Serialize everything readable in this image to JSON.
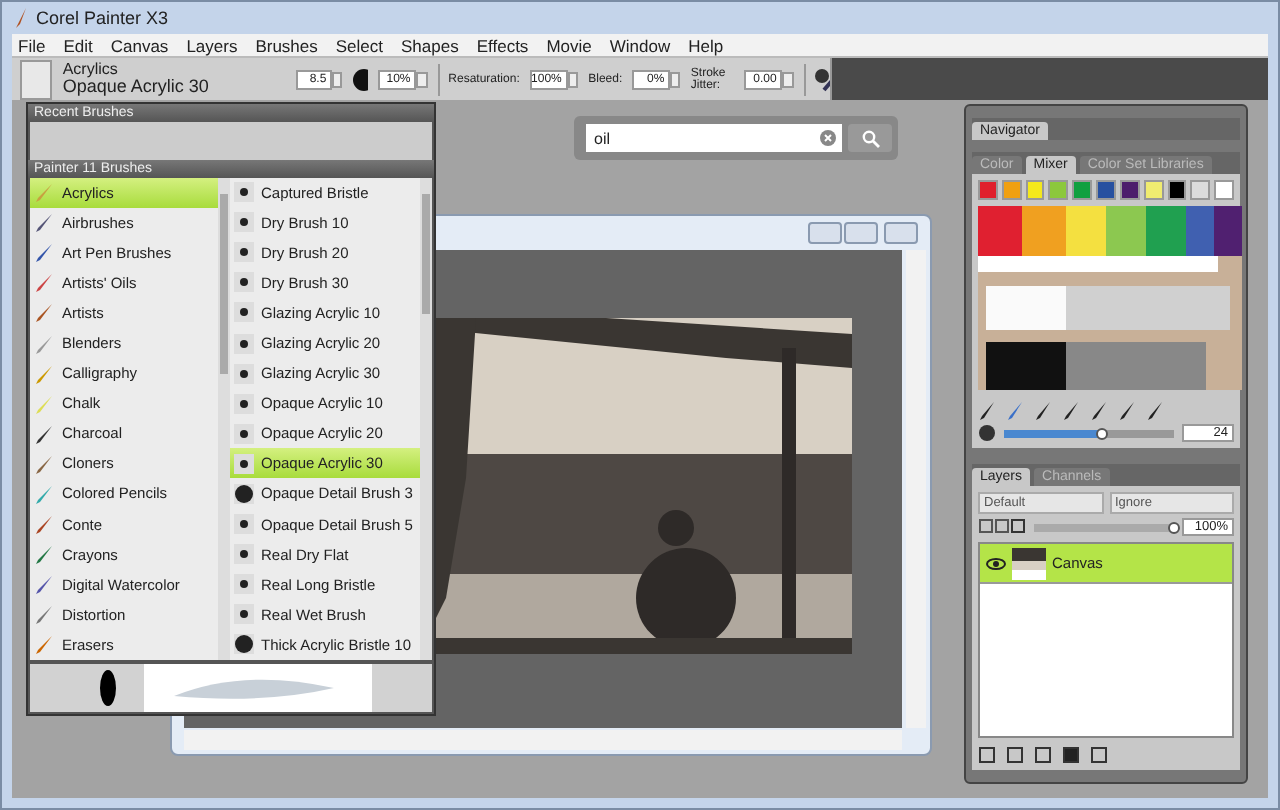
{
  "window": {
    "title": "Corel Painter X3"
  },
  "menu": [
    "File",
    "Edit",
    "Canvas",
    "Layers",
    "Brushes",
    "Select",
    "Shapes",
    "Effects",
    "Movie",
    "Window",
    "Help"
  ],
  "property_bar": {
    "category": "Acrylics",
    "variant": "Opaque Acrylic 30",
    "size": "8.5",
    "opacity": "10%",
    "resaturation_label": "Resaturation:",
    "resaturation": "100%",
    "bleed_label": "Bleed:",
    "bleed": "0%",
    "jitter_label": "Stroke Jitter:",
    "jitter": "0.00"
  },
  "brush_library": {
    "recent_title": "Recent Brushes",
    "library_title": "Painter 11 Brushes",
    "categories": [
      {
        "label": "Acrylics",
        "selected": true
      },
      {
        "label": "Airbrushes",
        "selected": false
      },
      {
        "label": "Art Pen Brushes",
        "selected": false
      },
      {
        "label": "Artists' Oils",
        "selected": false
      },
      {
        "label": "Artists",
        "selected": false
      },
      {
        "label": "Blenders",
        "selected": false
      },
      {
        "label": "Calligraphy",
        "selected": false
      },
      {
        "label": "Chalk",
        "selected": false
      },
      {
        "label": "Charcoal",
        "selected": false
      },
      {
        "label": "Cloners",
        "selected": false
      },
      {
        "label": "Colored Pencils",
        "selected": false
      },
      {
        "label": "Conte",
        "selected": false
      },
      {
        "label": "Crayons",
        "selected": false
      },
      {
        "label": "Digital Watercolor",
        "selected": false
      },
      {
        "label": "Distortion",
        "selected": false
      },
      {
        "label": "Erasers",
        "selected": false
      }
    ],
    "variants": [
      {
        "label": "Captured Bristle",
        "selected": false
      },
      {
        "label": "Dry Brush 10",
        "selected": false
      },
      {
        "label": "Dry Brush 20",
        "selected": false
      },
      {
        "label": "Dry Brush 30",
        "selected": false
      },
      {
        "label": "Glazing Acrylic 10",
        "selected": false
      },
      {
        "label": "Glazing Acrylic 20",
        "selected": false
      },
      {
        "label": "Glazing Acrylic 30",
        "selected": false
      },
      {
        "label": "Opaque Acrylic 10",
        "selected": false
      },
      {
        "label": "Opaque Acrylic 20",
        "selected": false
      },
      {
        "label": "Opaque Acrylic 30",
        "selected": true
      },
      {
        "label": "Opaque Detail Brush 3",
        "selected": false
      },
      {
        "label": "Opaque Detail Brush 5",
        "selected": false
      },
      {
        "label": "Real Dry Flat",
        "selected": false
      },
      {
        "label": "Real Long Bristle",
        "selected": false
      },
      {
        "label": "Real Wet Brush",
        "selected": false
      },
      {
        "label": "Thick Acrylic Bristle 10",
        "selected": false
      }
    ]
  },
  "search": {
    "value": "oil"
  },
  "navigator": {
    "title": "Navigator"
  },
  "color_panel": {
    "tabs": [
      {
        "label": "Color",
        "selected": false
      },
      {
        "label": "Mixer",
        "selected": true
      },
      {
        "label": "Color Set Libraries",
        "selected": false
      }
    ],
    "swatches": [
      {
        "color": "#e0202c"
      },
      {
        "color": "#f0a010"
      },
      {
        "color": "#f4e81c"
      },
      {
        "color": "#8cc83c"
      },
      {
        "color": "#10a040"
      },
      {
        "color": "#2850a0"
      },
      {
        "color": "#4c1c6c"
      },
      {
        "color": "#f0ec70"
      },
      {
        "color": "#000000"
      },
      {
        "color": "#dcdcdc"
      },
      {
        "color": "#ffffff"
      }
    ],
    "brush_size": {
      "level": 0.58,
      "value": "24"
    }
  },
  "layers_panel": {
    "tabs": [
      {
        "label": "Layers",
        "selected": true
      },
      {
        "label": "Channels",
        "selected": false
      }
    ],
    "composite_method": "Default",
    "composite_depth": "Ignore",
    "opacity": {
      "level": 1,
      "value": "100%"
    },
    "layers": [
      {
        "name": "Canvas",
        "selected": true,
        "visible": true
      }
    ]
  }
}
